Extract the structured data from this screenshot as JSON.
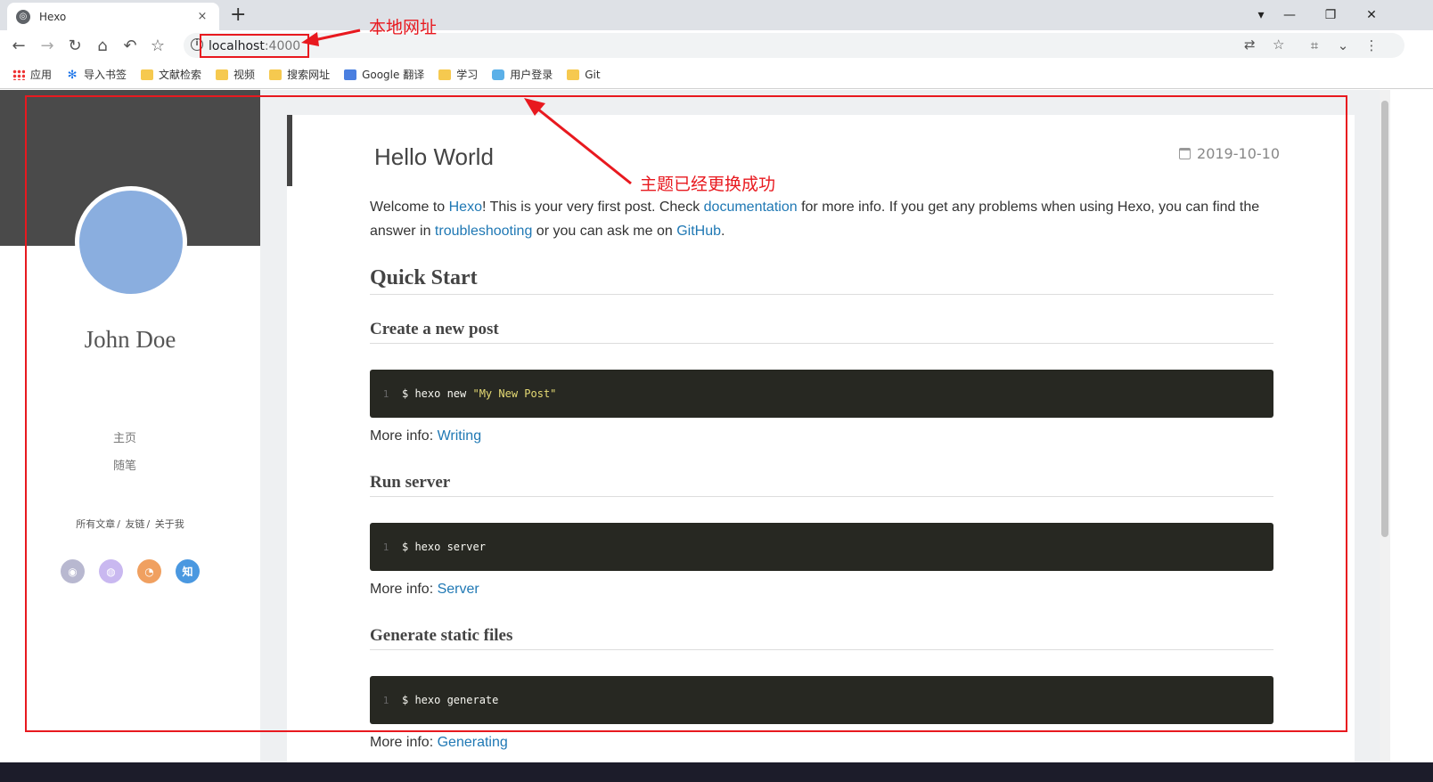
{
  "browser": {
    "tab_title": "Hexo",
    "new_tab": "+",
    "close_tab": "×",
    "url_host": "localhost",
    "url_port": ":4000",
    "controls": {
      "dropdown": "▾",
      "minimize": "—",
      "restore": "❐",
      "close": "✕"
    },
    "nav_icons": [
      "back-icon",
      "forward-icon",
      "reload-icon",
      "home-icon",
      "undo-icon",
      "star-icon"
    ],
    "bookmarks": [
      {
        "label": "应用",
        "icon": "apps-icon"
      },
      {
        "label": "导入书签",
        "icon": "gear-icon"
      },
      {
        "label": "文献检索",
        "icon": "folder-icon"
      },
      {
        "label": "视频",
        "icon": "folder-icon"
      },
      {
        "label": "搜索网址",
        "icon": "folder-icon"
      },
      {
        "label": "Google 翻译",
        "icon": "google-translate-icon"
      },
      {
        "label": "学习",
        "icon": "folder-icon"
      },
      {
        "label": "用户登录",
        "icon": "user-icon"
      },
      {
        "label": "Git",
        "icon": "folder-icon"
      }
    ]
  },
  "sidebar": {
    "author": "John Doe",
    "menu": [
      "主页",
      "随笔"
    ],
    "footer_links": [
      "所有文章",
      "友链",
      "关于我"
    ],
    "separator": "/",
    "socials": [
      {
        "name": "github",
        "glyph": "◉",
        "color": "#b8b8d0"
      },
      {
        "name": "weibo",
        "glyph": "◍",
        "color": "#c9b8f0"
      },
      {
        "name": "rss",
        "glyph": "◔",
        "color": "#f0a060"
      },
      {
        "name": "zhihu",
        "glyph": "知",
        "color": "#4a98e0"
      }
    ]
  },
  "post": {
    "title": "Hello World",
    "date": "2019-10-10",
    "intro": {
      "t1": "Welcome to ",
      "l1": "Hexo",
      "t2": "! This is your very first post. Check ",
      "l2": "documentation",
      "t3": " for more info. If you get any problems when using Hexo, you can find the answer in ",
      "l3": "troubleshooting",
      "t4": " or you can ask me on ",
      "l4": "GitHub",
      "t5": "."
    },
    "quick_start": "Quick Start",
    "more_info_label": "More info: ",
    "sections": [
      {
        "heading": "Create a new post",
        "line_no": "1",
        "cmd": "$ hexo new ",
        "arg": "\"My New Post\"",
        "link": "Writing"
      },
      {
        "heading": "Run server",
        "line_no": "1",
        "cmd": "$ hexo server",
        "arg": "",
        "link": "Server"
      },
      {
        "heading": "Generate static files",
        "line_no": "1",
        "cmd": "$ hexo generate",
        "arg": "",
        "link": "Generating"
      }
    ]
  },
  "annotations": {
    "local_url": "本地网址",
    "theme_changed": "主题已经更换成功",
    "color": "#e8191f"
  }
}
